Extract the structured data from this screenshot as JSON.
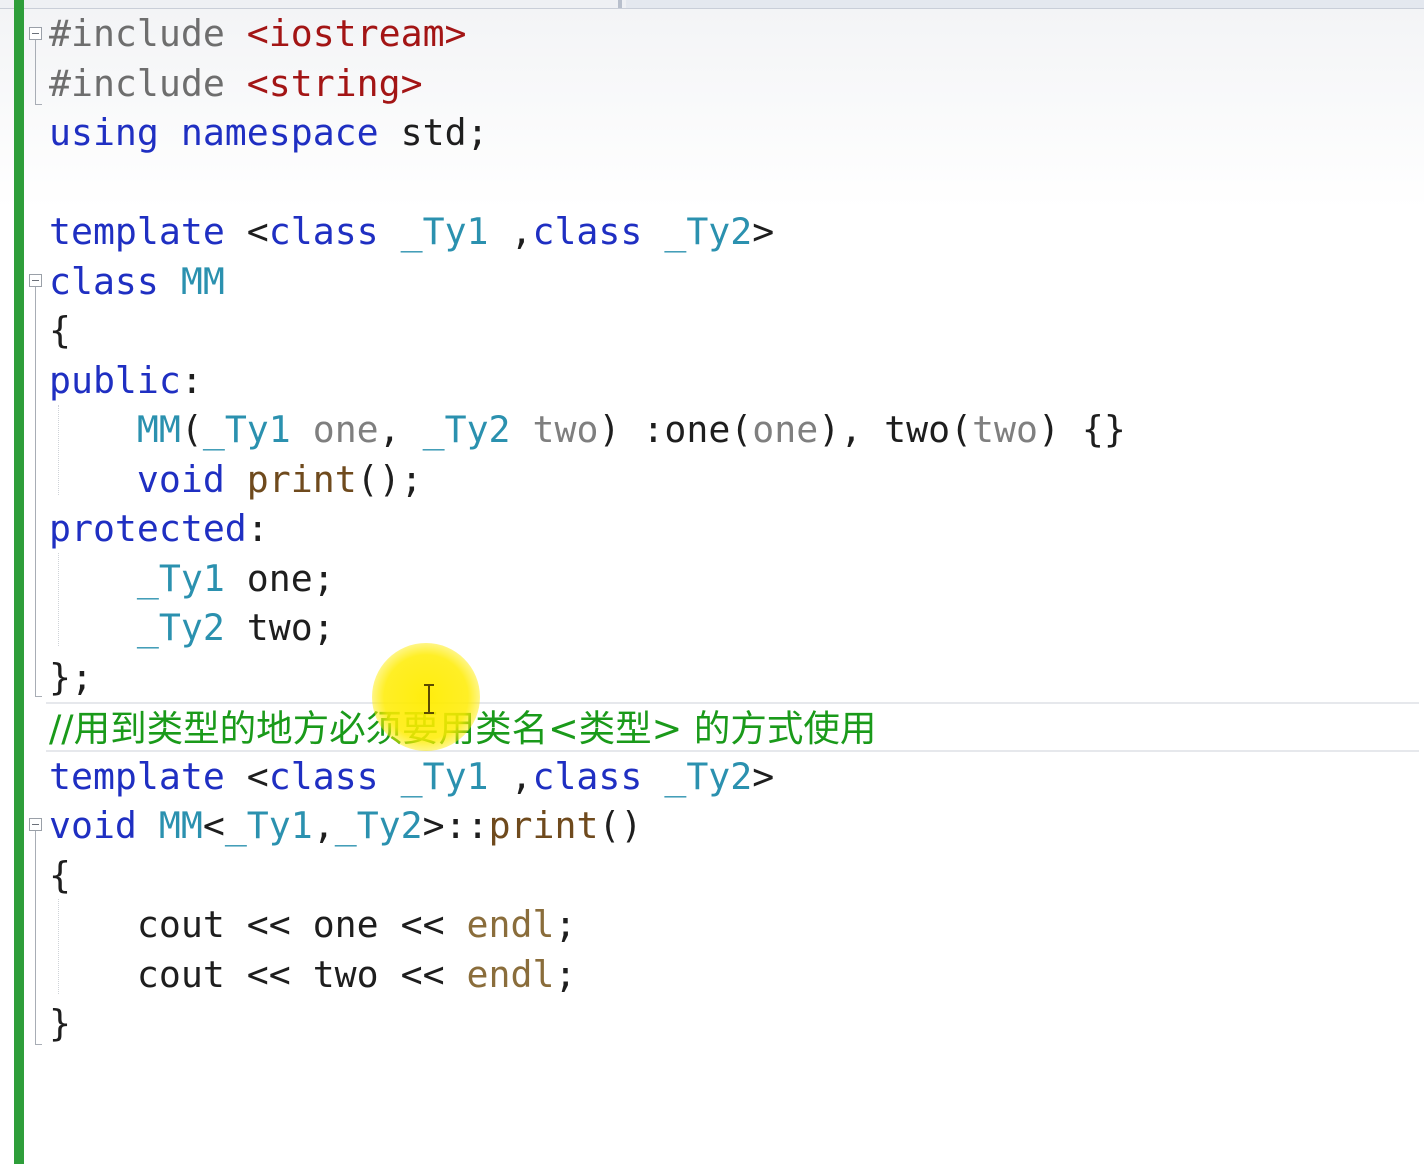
{
  "editor": {
    "lines": [
      [
        {
          "t": "#include ",
          "c": "pp"
        },
        {
          "t": "<iostream>",
          "c": "str"
        }
      ],
      [
        {
          "t": "#include ",
          "c": "pp"
        },
        {
          "t": "<string>",
          "c": "str"
        }
      ],
      [
        {
          "t": "using",
          "c": "kw"
        },
        {
          "t": " "
        },
        {
          "t": "namespace",
          "c": "kw"
        },
        {
          "t": " std;"
        }
      ],
      [],
      [
        {
          "t": "template",
          "c": "kw"
        },
        {
          "t": " <"
        },
        {
          "t": "class",
          "c": "kw"
        },
        {
          "t": " "
        },
        {
          "t": "_Ty1",
          "c": "ty"
        },
        {
          "t": " ,"
        },
        {
          "t": "class",
          "c": "kw"
        },
        {
          "t": " "
        },
        {
          "t": "_Ty2",
          "c": "ty"
        },
        {
          "t": ">"
        }
      ],
      [
        {
          "t": "class",
          "c": "kw"
        },
        {
          "t": " "
        },
        {
          "t": "MM",
          "c": "ty"
        }
      ],
      [
        {
          "t": "{"
        }
      ],
      [
        {
          "t": "public",
          "c": "kw"
        },
        {
          "t": ":"
        }
      ],
      [
        {
          "t": "    "
        },
        {
          "t": "MM",
          "c": "ty"
        },
        {
          "t": "("
        },
        {
          "t": "_Ty1",
          "c": "ty"
        },
        {
          "t": " "
        },
        {
          "t": "one",
          "c": "pm"
        },
        {
          "t": ", "
        },
        {
          "t": "_Ty2",
          "c": "ty"
        },
        {
          "t": " "
        },
        {
          "t": "two",
          "c": "pm"
        },
        {
          "t": ") :one("
        },
        {
          "t": "one",
          "c": "pm"
        },
        {
          "t": "), two("
        },
        {
          "t": "two",
          "c": "pm"
        },
        {
          "t": ") {}"
        }
      ],
      [
        {
          "t": "    "
        },
        {
          "t": "void",
          "c": "kw"
        },
        {
          "t": " "
        },
        {
          "t": "print",
          "c": "fn"
        },
        {
          "t": "();"
        }
      ],
      [
        {
          "t": "protected",
          "c": "kw"
        },
        {
          "t": ":"
        }
      ],
      [
        {
          "t": "    "
        },
        {
          "t": "_Ty1",
          "c": "ty"
        },
        {
          "t": " one;"
        }
      ],
      [
        {
          "t": "    "
        },
        {
          "t": "_Ty2",
          "c": "ty"
        },
        {
          "t": " two;"
        }
      ],
      [
        {
          "t": "};"
        }
      ],
      [
        {
          "t": "//用到类型的地方必须要用类名<类型> 的方式使用",
          "c": "cm"
        }
      ],
      [
        {
          "t": "template",
          "c": "kw"
        },
        {
          "t": " <"
        },
        {
          "t": "class",
          "c": "kw"
        },
        {
          "t": " "
        },
        {
          "t": "_Ty1",
          "c": "ty"
        },
        {
          "t": " ,"
        },
        {
          "t": "class",
          "c": "kw"
        },
        {
          "t": " "
        },
        {
          "t": "_Ty2",
          "c": "ty"
        },
        {
          "t": ">"
        }
      ],
      [
        {
          "t": "void",
          "c": "kw"
        },
        {
          "t": " "
        },
        {
          "t": "MM",
          "c": "ty"
        },
        {
          "t": "<"
        },
        {
          "t": "_Ty1",
          "c": "ty"
        },
        {
          "t": ","
        },
        {
          "t": "_Ty2",
          "c": "ty"
        },
        {
          "t": ">::"
        },
        {
          "t": "print",
          "c": "fn"
        },
        {
          "t": "()"
        }
      ],
      [
        {
          "t": "{"
        }
      ],
      [
        {
          "t": "    cout << one << "
        },
        {
          "t": "endl",
          "c": "mc"
        },
        {
          "t": ";"
        }
      ],
      [
        {
          "t": "    cout << two << "
        },
        {
          "t": "endl",
          "c": "mc"
        },
        {
          "t": ";"
        }
      ],
      [
        {
          "t": "}"
        }
      ]
    ],
    "current_line": 14
  },
  "colors": {
    "keyword": "#1f2fc2",
    "preprocessor": "#6e6e6e",
    "string": "#a31515",
    "type": "#2b91af",
    "parameter": "#7f7f7f",
    "function": "#6f4a1d",
    "macro": "#8a6d3b",
    "comment": "#1a9a1a",
    "change_bar": "#2e9e3a",
    "cursor_highlight": "#ffec00"
  },
  "icons": {
    "fold": "outline-collapse-icon",
    "cursor": "text-ibeam-cursor-icon"
  }
}
